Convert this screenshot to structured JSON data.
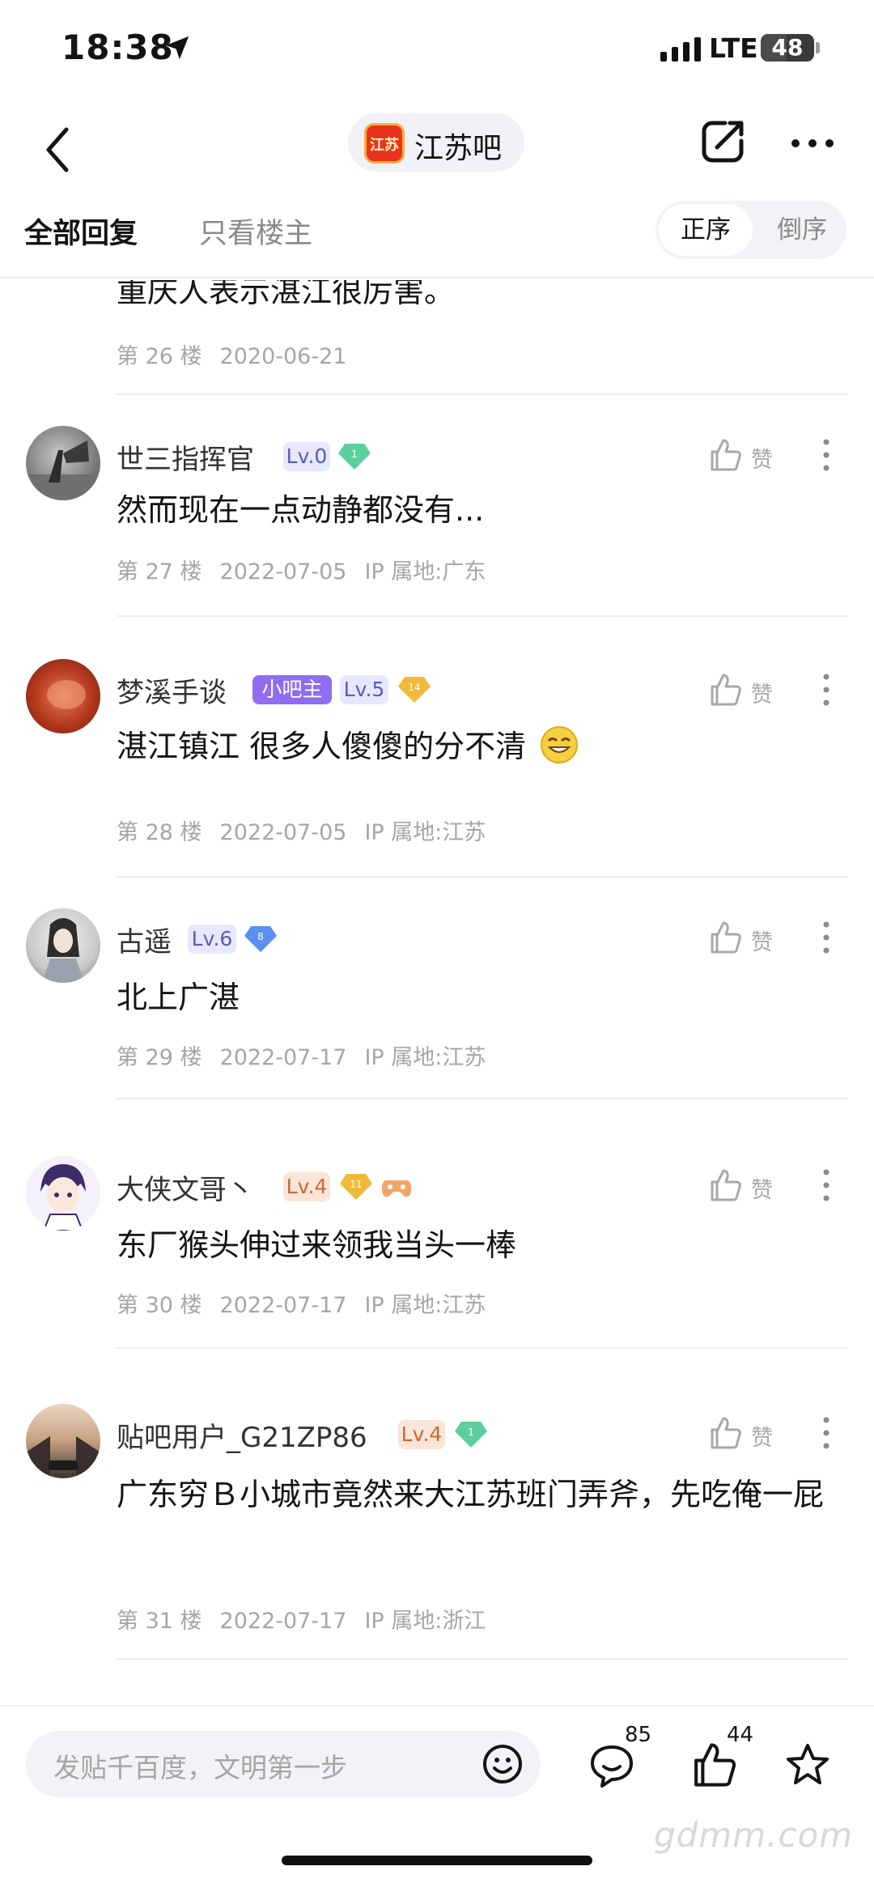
{
  "status_bar": {
    "time": "18:38",
    "network": "LTE",
    "battery": "48"
  },
  "nav": {
    "forum_name": "江苏吧",
    "forum_logo_text": "江苏"
  },
  "tabs": {
    "all_replies": "全部回复",
    "owner_only": "只看楼主",
    "order_asc": "正序",
    "order_desc": "倒序"
  },
  "posts": [
    {
      "content": "重庆人表示湛江很厉害。",
      "floor": "第 26 楼",
      "date": "2020-06-21"
    },
    {
      "user": "世三指挥官",
      "level": "Lv.0",
      "gem": "1",
      "content": "然而现在一点动静都没有...",
      "floor": "第 27 楼",
      "date": "2022-07-05",
      "ip": "IP 属地:广东",
      "like": "赞"
    },
    {
      "user": "梦溪手谈",
      "owner_badge": "小吧主",
      "level": "Lv.5",
      "gem": "14",
      "content": "湛江镇江 很多人傻傻的分不清",
      "floor": "第 28 楼",
      "date": "2022-07-05",
      "ip": "IP 属地:江苏",
      "like": "赞"
    },
    {
      "user": "古遥",
      "level": "Lv.6",
      "gem": "8",
      "content": "北上广湛",
      "floor": "第 29 楼",
      "date": "2022-07-17",
      "ip": "IP 属地:江苏",
      "like": "赞"
    },
    {
      "user": "大侠文哥丶",
      "level": "Lv.4",
      "gem": "11",
      "content": "东厂猴头伸过来领我当头一棒",
      "floor": "第 30 楼",
      "date": "2022-07-17",
      "ip": "IP 属地:江苏",
      "like": "赞"
    },
    {
      "user": "贴吧用户_G21ZP86",
      "level": "Lv.4",
      "gem": "1",
      "content": "广东穷Ｂ小城市竟然来大江苏班门弄斧，先吃俺一屁",
      "floor": "第 31 楼",
      "date": "2022-07-17",
      "ip": "IP 属地:浙江",
      "like": "赞"
    }
  ],
  "bottom_bar": {
    "placeholder": "发贴千百度，文明第一步",
    "comment_count": "85",
    "like_count": "44"
  },
  "watermark": "gdmm.com",
  "colors": {
    "accent": "#8f6cf0",
    "gem_green": "#5ccf9e",
    "gem_gold": "#f1b93c",
    "gem_blue": "#5b8ff0"
  }
}
